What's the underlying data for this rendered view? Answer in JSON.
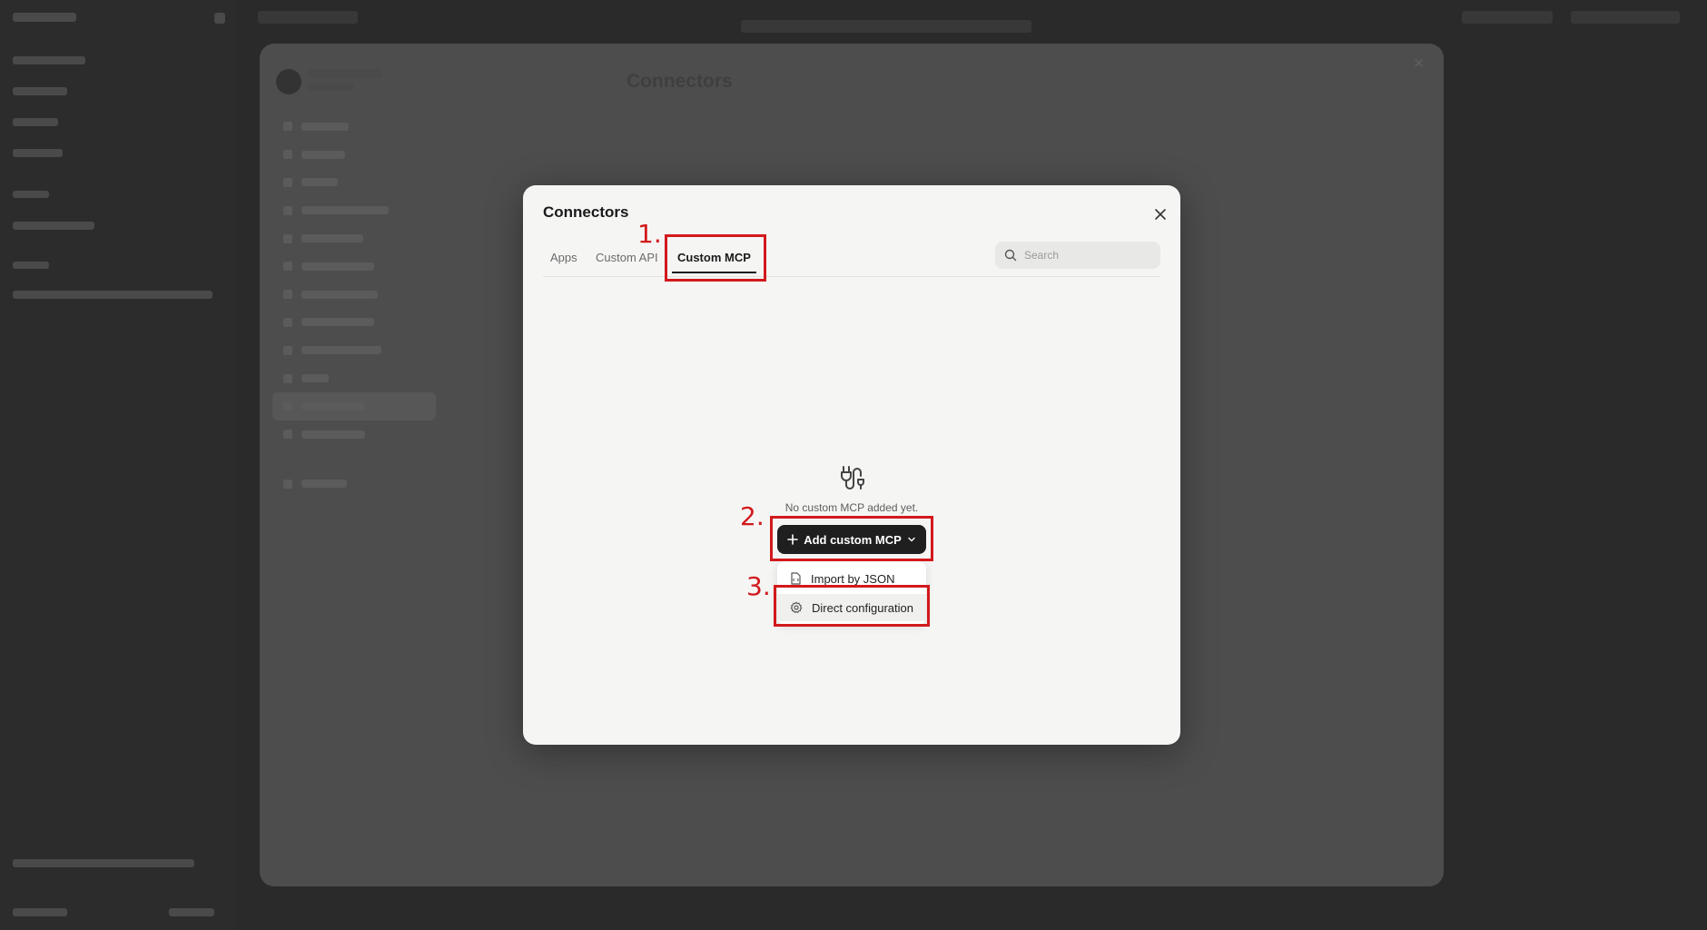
{
  "modal": {
    "title": "Connectors",
    "tabs": [
      {
        "label": "Apps",
        "active": false
      },
      {
        "label": "Custom API",
        "active": false
      },
      {
        "label": "Custom MCP",
        "active": true
      }
    ],
    "search": {
      "placeholder": "Search"
    },
    "empty_state": {
      "icon": "plug-connector-icon",
      "message": "No custom MCP added yet."
    },
    "add_button": {
      "label": "Add custom MCP",
      "icon_left": "plus-icon",
      "icon_right": "chevron-down-icon"
    },
    "dropdown": [
      {
        "label": "Import by JSON",
        "icon": "json-file-icon"
      },
      {
        "label": "Direct configuration",
        "icon": "gear-icon"
      }
    ]
  },
  "annotations": {
    "step1": "1.",
    "step2": "2.",
    "step3": "3.",
    "color": "#d2191c"
  },
  "background": {
    "panel_title": "Connectors"
  }
}
